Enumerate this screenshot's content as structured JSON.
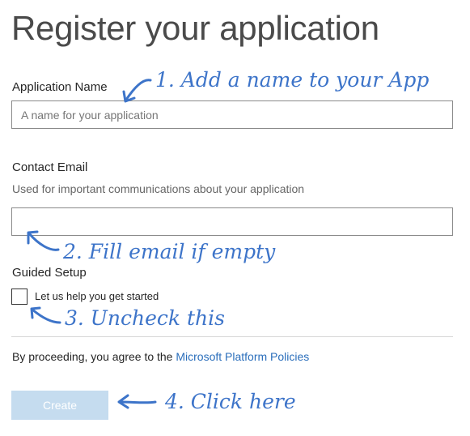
{
  "page": {
    "title": "Register your application"
  },
  "app_name": {
    "label": "Application Name",
    "value": "",
    "placeholder": "A name for your application"
  },
  "contact_email": {
    "label": "Contact Email",
    "help": "Used for important communications about your application",
    "value": ""
  },
  "guided_setup": {
    "label": "Guided Setup",
    "checkbox_label": "Let us help you get started",
    "checked": false
  },
  "footer": {
    "agree_text": "By proceeding, you agree to the ",
    "policy_link": "Microsoft Platform Policies",
    "create_button": "Create"
  },
  "annotations": {
    "step1": "1. Add a name to your App",
    "step2": "2. Fill email if empty",
    "step3": "3. Uncheck this",
    "step4": "4. Click here",
    "color": "#3d74c9"
  },
  "colors": {
    "link": "#2a6ebb",
    "button_disabled_bg": "#c5dcef",
    "input_border": "#8a8a8a",
    "divider": "#d6d6d6"
  }
}
